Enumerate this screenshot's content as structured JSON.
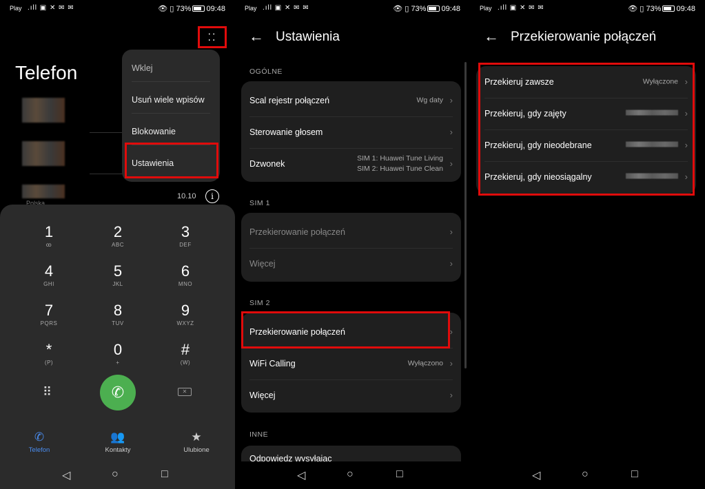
{
  "status": {
    "carrier": "Play",
    "battery": "73%",
    "time": "09:48"
  },
  "panel1": {
    "title": "Telefon",
    "menu": [
      "Wklej",
      "Usuń wiele wpisów",
      "Blokowanie",
      "Ustawienia"
    ],
    "recent_country": "Polska",
    "recent_time": "10.10",
    "keys": [
      {
        "num": "1",
        "letters": "ꝏ"
      },
      {
        "num": "2",
        "letters": "ABC"
      },
      {
        "num": "3",
        "letters": "DEF"
      },
      {
        "num": "4",
        "letters": "GHI"
      },
      {
        "num": "5",
        "letters": "JKL"
      },
      {
        "num": "6",
        "letters": "MNO"
      },
      {
        "num": "7",
        "letters": "PQRS"
      },
      {
        "num": "8",
        "letters": "TUV"
      },
      {
        "num": "9",
        "letters": "WXYZ"
      },
      {
        "num": "*",
        "letters": "(P)"
      },
      {
        "num": "0",
        "letters": "+"
      },
      {
        "num": "#",
        "letters": "(W)"
      }
    ],
    "tabs": [
      "Telefon",
      "Kontakty",
      "Ulubione"
    ]
  },
  "panel2": {
    "title": "Ustawienia",
    "sections": {
      "general": "OGÓLNE",
      "sim1": "SIM 1",
      "sim2": "SIM 2",
      "other": "INNE"
    },
    "general_rows": [
      {
        "label": "Scal rejestr połączeń",
        "value": "Wg daty"
      },
      {
        "label": "Sterowanie głosem",
        "value": ""
      },
      {
        "label": "Dzwonek",
        "value1": "SIM 1: Huawei Tune Living",
        "value2": "SIM 2: Huawei Tune Clean"
      }
    ],
    "sim1_rows": [
      "Przekierowanie połączeń",
      "Więcej"
    ],
    "sim2_rows": [
      {
        "label": "Przekierowanie połączeń",
        "value": ""
      },
      {
        "label": "WiFi Calling",
        "value": "Wyłączono"
      },
      {
        "label": "Więcej",
        "value": ""
      }
    ],
    "other_rows": [
      "Odpowiedz wysyłając"
    ]
  },
  "panel3": {
    "title": "Przekierowanie połączeń",
    "rows": [
      {
        "label": "Przekieruj zawsze",
        "value": "Wyłączone"
      },
      {
        "label": "Przekieruj, gdy zajęty",
        "value": ""
      },
      {
        "label": "Przekieruj, gdy nieodebrane",
        "value": ""
      },
      {
        "label": "Przekieruj, gdy nieosiągalny",
        "value": ""
      }
    ]
  },
  "colors": {
    "highlight": "#e10b0b",
    "call_green": "#4caf50",
    "active_tab": "#4a8df0"
  }
}
